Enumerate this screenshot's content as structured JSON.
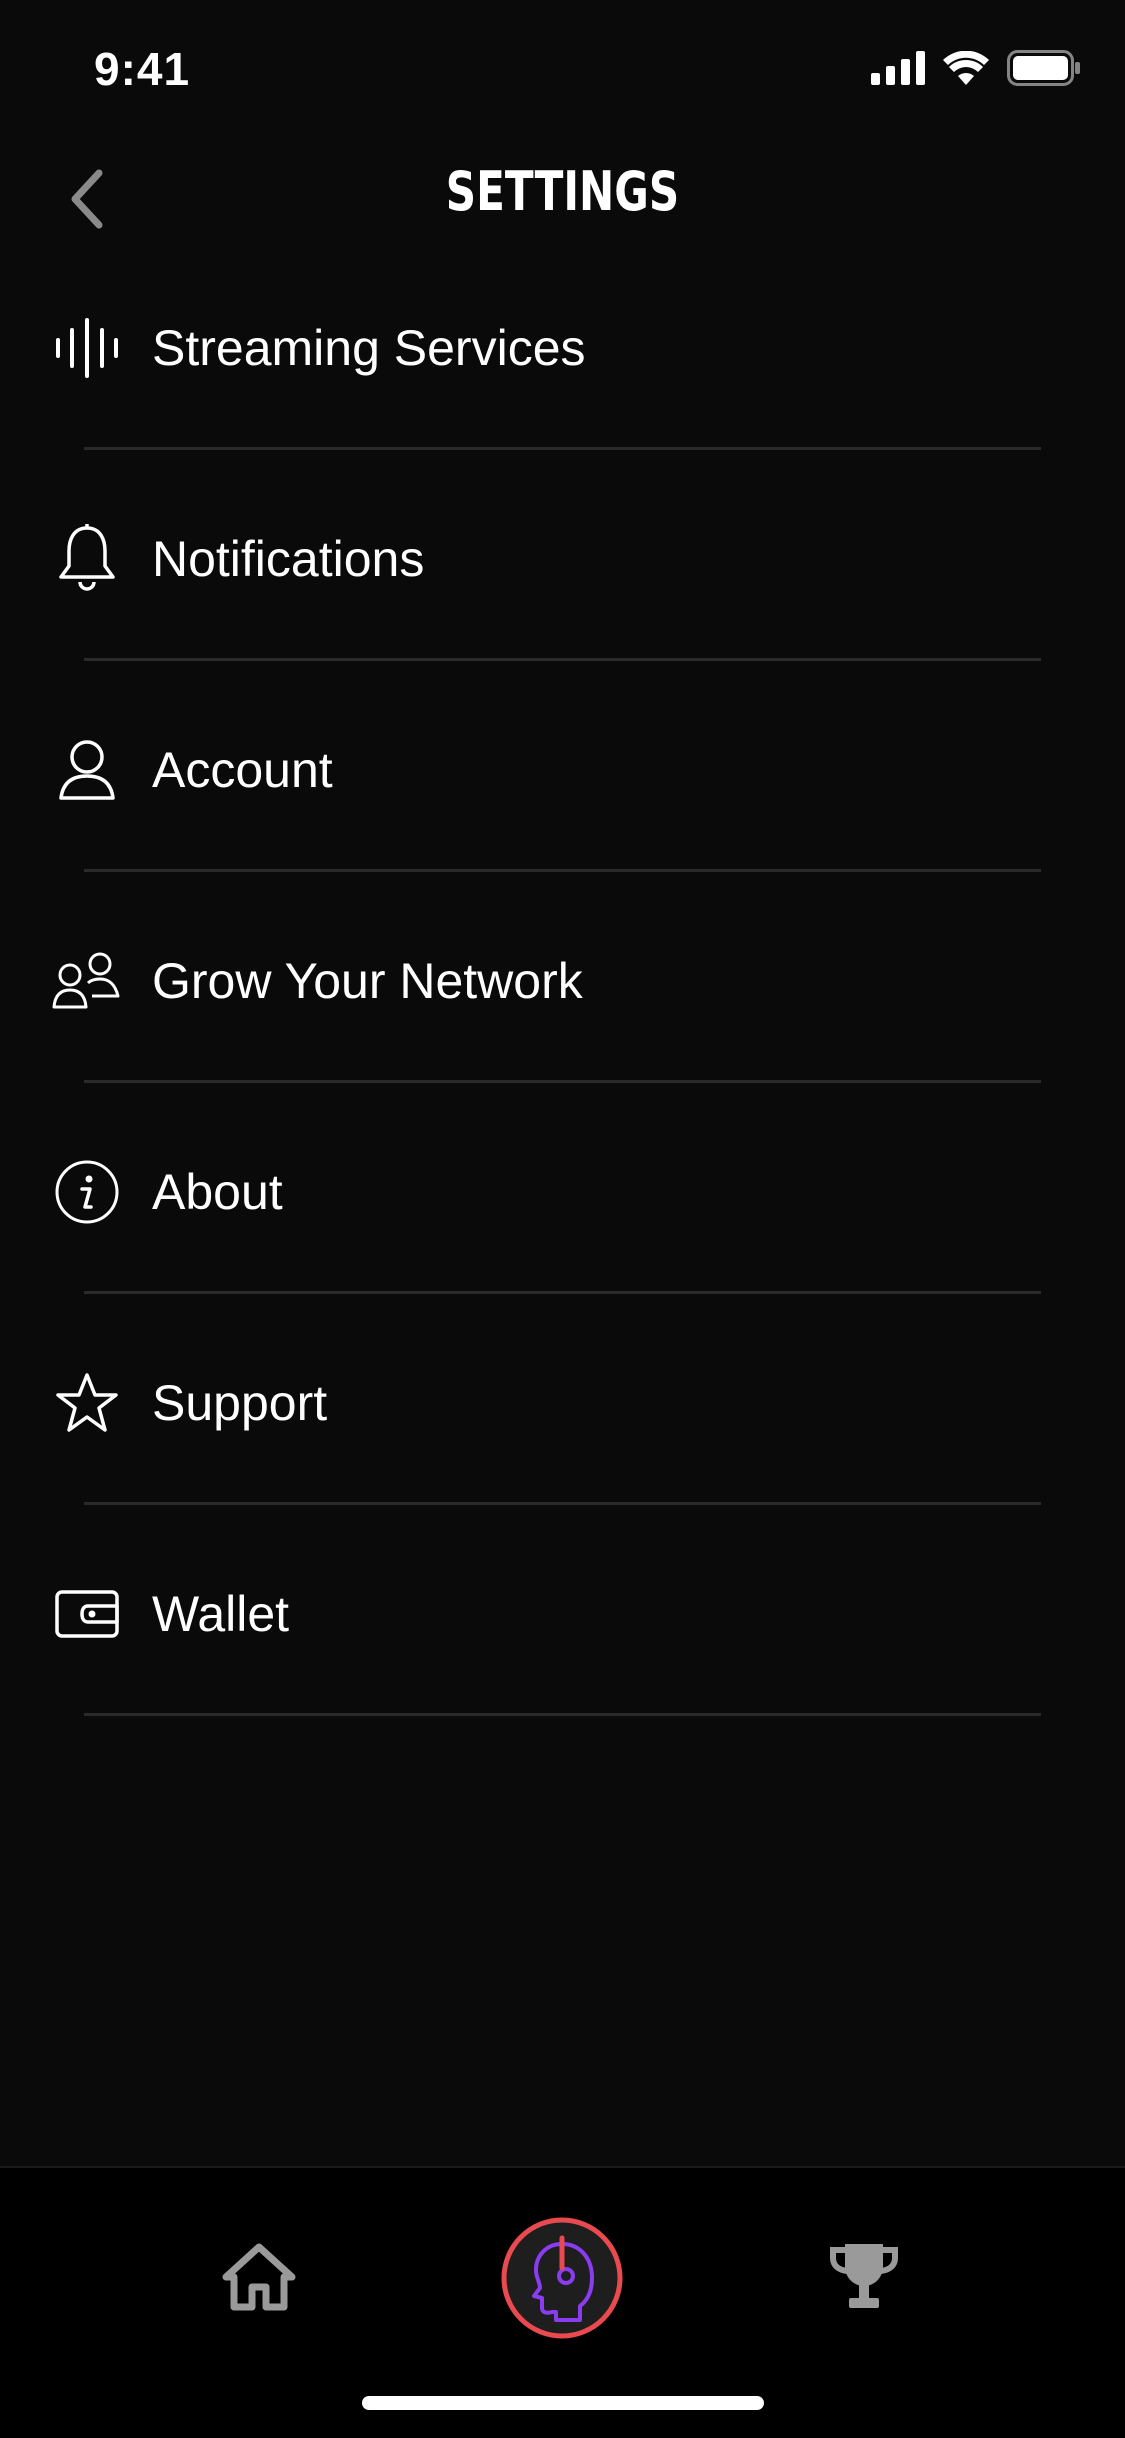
{
  "status_bar": {
    "time": "9:41"
  },
  "header": {
    "title": "SETTINGS"
  },
  "settings": {
    "items": [
      {
        "label": "Streaming Services",
        "icon": "waveform-icon"
      },
      {
        "label": "Notifications",
        "icon": "bell-icon"
      },
      {
        "label": "Account",
        "icon": "user-icon"
      },
      {
        "label": "Grow Your Network",
        "icon": "users-icon"
      },
      {
        "label": "About",
        "icon": "info-icon"
      },
      {
        "label": "Support",
        "icon": "star-icon"
      },
      {
        "label": "Wallet",
        "icon": "wallet-icon"
      }
    ]
  },
  "bottom_nav": {
    "items": [
      "home-icon",
      "profile-head-icon",
      "trophy-icon"
    ],
    "active": "profile-head-icon"
  },
  "colors": {
    "background": "#0a0a0a",
    "text": "#ffffff",
    "divider": "#2a2a2a",
    "accent_ring": "#e84a4f",
    "accent_purple": "#8a3cf0",
    "nav_icon": "#9a9a9a"
  }
}
